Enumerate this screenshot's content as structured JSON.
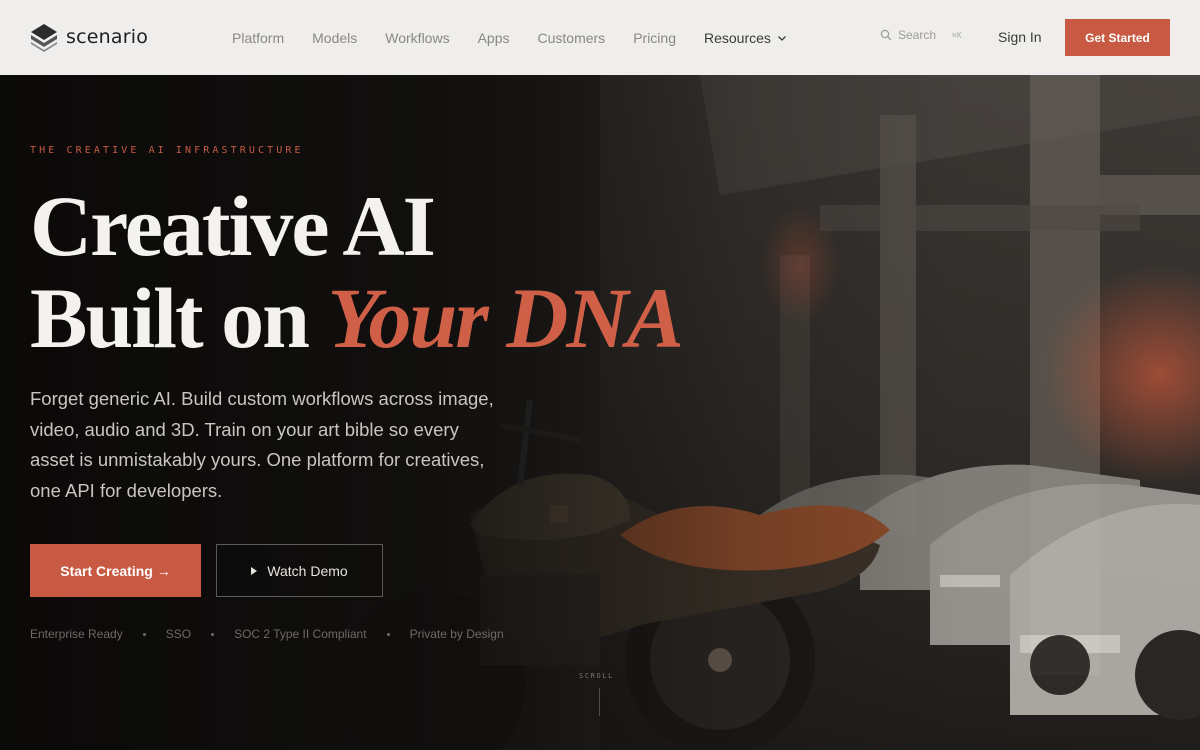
{
  "brand": {
    "name": "scenario"
  },
  "nav": {
    "links": [
      "Platform",
      "Models",
      "Workflows",
      "Apps",
      "Customers",
      "Pricing"
    ],
    "resources": "Resources",
    "search_placeholder": "Search",
    "search_shortcut": "⌘K",
    "sign_in": "Sign In",
    "get_started": "Get Started"
  },
  "hero": {
    "eyebrow": "THE CREATIVE AI INFRASTRUCTURE",
    "headline_line1": "Creative AI",
    "headline_line2_plain": "Built on ",
    "headline_line2_accent": "Your DNA",
    "subtext": "Forget generic AI. Build custom workflows across image, video, audio and 3D. Train on your art bible so every asset is unmistakably yours. One platform for creatives, one API for developers.",
    "primary_cta": "Start Creating →",
    "secondary_cta": "Watch Demo",
    "badges": [
      "Enterprise Ready",
      "SSO",
      "SOC 2 Type II Compliant",
      "Private by Design"
    ],
    "scroll_label": "SCROLL"
  },
  "colors": {
    "accent": "#c85a44",
    "nav_bg": "#efeeec",
    "hero_text": "#f4f2ee"
  }
}
